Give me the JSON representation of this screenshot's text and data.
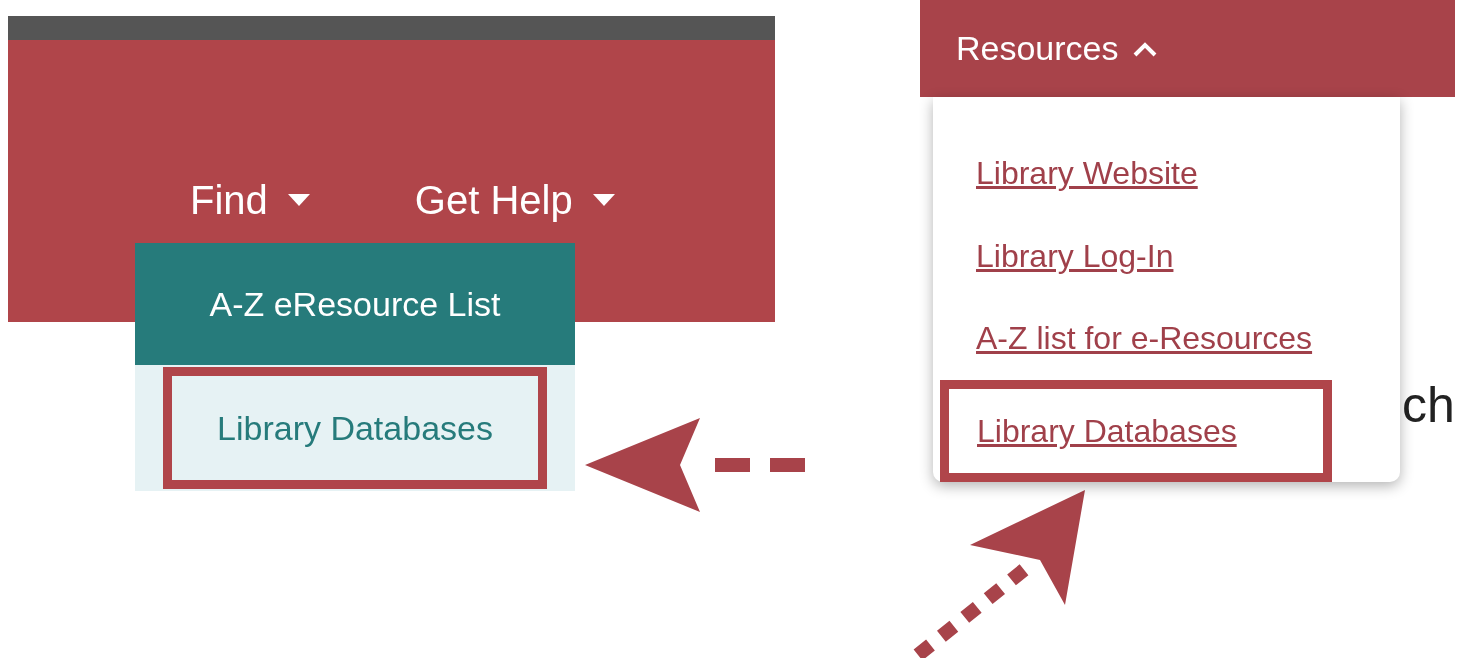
{
  "left_screenshot": {
    "nav_items": [
      {
        "label": "Find"
      },
      {
        "label": "Get Help"
      }
    ],
    "dropdown_items": [
      {
        "label": "A-Z eResource List",
        "selected": true,
        "highlighted": false
      },
      {
        "label": "Library Databases",
        "selected": false,
        "highlighted": true
      }
    ]
  },
  "right_screenshot": {
    "menu_label": "Resources",
    "expanded": true,
    "dropdown_items": [
      {
        "label": "Library Website",
        "highlighted": false
      },
      {
        "label": "Library Log-In",
        "highlighted": false
      },
      {
        "label": "A-Z list for e-Resources",
        "highlighted": false
      },
      {
        "label": "Library Databases",
        "highlighted": true
      }
    ],
    "page_text": "ch"
  }
}
